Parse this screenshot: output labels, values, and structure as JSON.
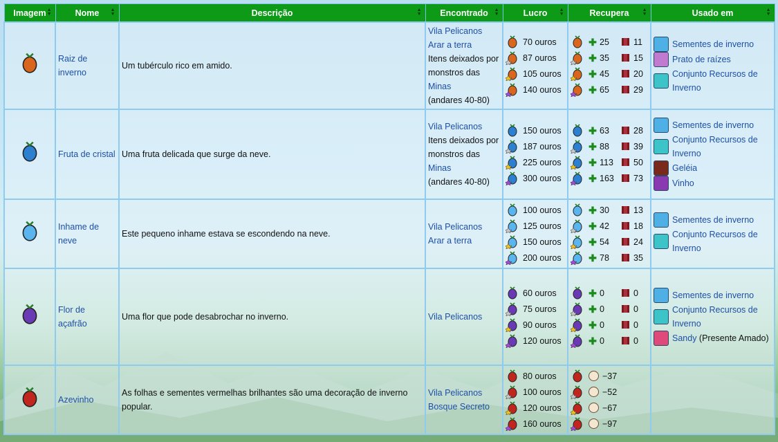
{
  "headers": [
    "Imagem",
    "Nome",
    "Descrição",
    "Encontrado",
    "Lucro",
    "Recupera",
    "Usado em"
  ],
  "rows": [
    {
      "icon": "winter-root-icon",
      "color": "#d9661e",
      "name": "Raiz de inverno",
      "desc": "Um tubérculo rico em amido.",
      "found": [
        {
          "text": "Vila Pelicanos",
          "link": true
        },
        {
          "text": "Arar a terra",
          "link": true
        },
        {
          "text": "Itens deixados por monstros das",
          "link": false
        },
        {
          "text": "Minas",
          "link": true
        },
        {
          "text": "(andares 40-80)",
          "link": false
        }
      ],
      "profit": [
        "70 ouros",
        "87 ouros",
        "105 ouros",
        "140 ouros"
      ],
      "energy": [
        "25",
        "35",
        "45",
        "65"
      ],
      "health": [
        "11",
        "15",
        "20",
        "29"
      ],
      "recovery_type": "energy_health",
      "used": [
        {
          "text": "Sementes de inverno",
          "icon": "seed-packet-icon",
          "color": "#4fb0e6"
        },
        {
          "text": "Prato de raízes",
          "icon": "root-platter-icon",
          "color": "#c07ad0"
        },
        {
          "text": "Conjunto Recursos de Inverno",
          "icon": "bundle-icon",
          "color": "#3cc4c8"
        }
      ]
    },
    {
      "icon": "crystal-fruit-icon",
      "color": "#2d7fd0",
      "name": "Fruta de cristal",
      "desc": "Uma fruta delicada que surge da neve.",
      "found": [
        {
          "text": "Vila Pelicanos",
          "link": true
        },
        {
          "text": "Itens deixados por monstros das",
          "link": false
        },
        {
          "text": "Minas",
          "link": true
        },
        {
          "text": "(andares 40-80)",
          "link": false
        }
      ],
      "profit": [
        "150 ouros",
        "187 ouros",
        "225 ouros",
        "300 ouros"
      ],
      "energy": [
        "63",
        "88",
        "113",
        "163"
      ],
      "health": [
        "28",
        "39",
        "50",
        "73"
      ],
      "recovery_type": "energy_health",
      "used": [
        {
          "text": "Sementes de inverno",
          "icon": "seed-packet-icon",
          "color": "#4fb0e6"
        },
        {
          "text": "Conjunto Recursos de Inverno",
          "icon": "bundle-icon",
          "color": "#3cc4c8"
        },
        {
          "text": "Geléia",
          "icon": "jelly-jar-icon",
          "color": "#7a2a1a"
        },
        {
          "text": "Vinho",
          "icon": "wine-bottle-icon",
          "color": "#8a3ab0"
        }
      ]
    },
    {
      "icon": "snow-yam-icon",
      "color": "#5ab4ee",
      "name": "Inhame de neve",
      "desc": "Este pequeno inhame estava se escondendo na neve.",
      "found": [
        {
          "text": "Vila Pelicanos",
          "link": true
        },
        {
          "text": "Arar a terra",
          "link": true
        }
      ],
      "profit": [
        "100 ouros",
        "125 ouros",
        "150 ouros",
        "200 ouros"
      ],
      "energy": [
        "30",
        "42",
        "54",
        "78"
      ],
      "health": [
        "13",
        "18",
        "24",
        "35"
      ],
      "recovery_type": "energy_health",
      "used": [
        {
          "text": "Sementes de inverno",
          "icon": "seed-packet-icon",
          "color": "#4fb0e6"
        },
        {
          "text": "Conjunto Recursos de Inverno",
          "icon": "bundle-icon",
          "color": "#3cc4c8"
        }
      ]
    },
    {
      "icon": "crocus-icon",
      "color": "#6a3ab4",
      "name": "Flor de açafrão",
      "desc": "Uma flor que pode desabrochar no inverno.",
      "found": [
        {
          "text": "Vila Pelicanos",
          "link": true
        }
      ],
      "profit": [
        "60 ouros",
        "75 ouros",
        "90 ouros",
        "120 ouros"
      ],
      "energy": [
        "0",
        "0",
        "0",
        "0"
      ],
      "health": [
        "0",
        "0",
        "0",
        "0"
      ],
      "recovery_type": "energy_health",
      "used": [
        {
          "text": "Sementes de inverno",
          "icon": "seed-packet-icon",
          "color": "#4fb0e6"
        },
        {
          "text": "Conjunto Recursos de Inverno",
          "icon": "bundle-icon",
          "color": "#3cc4c8"
        },
        {
          "text": "Sandy",
          "suffix": " (Presente Amado)",
          "icon": "sandy-portrait-icon",
          "color": "#e04a7a"
        }
      ]
    },
    {
      "icon": "holly-icon",
      "color": "#c0261e",
      "name": "Azevinho",
      "desc": "As folhas e sementes vermelhas brilhantes são uma decoração de inverno popular.",
      "found": [
        {
          "text": "Vila Pelicanos",
          "link": true
        },
        {
          "text": "Bosque Secreto",
          "link": true
        }
      ],
      "profit": [
        "80 ouros",
        "100 ouros",
        "120 ouros",
        "160 ouros"
      ],
      "energy": [
        "−37",
        "−52",
        "−67",
        "−97"
      ],
      "health": [],
      "recovery_type": "poison",
      "used": []
    }
  ],
  "quality_colors": [
    "none",
    "#c8c8c8",
    "#f2c21c",
    "#a24ad6"
  ]
}
